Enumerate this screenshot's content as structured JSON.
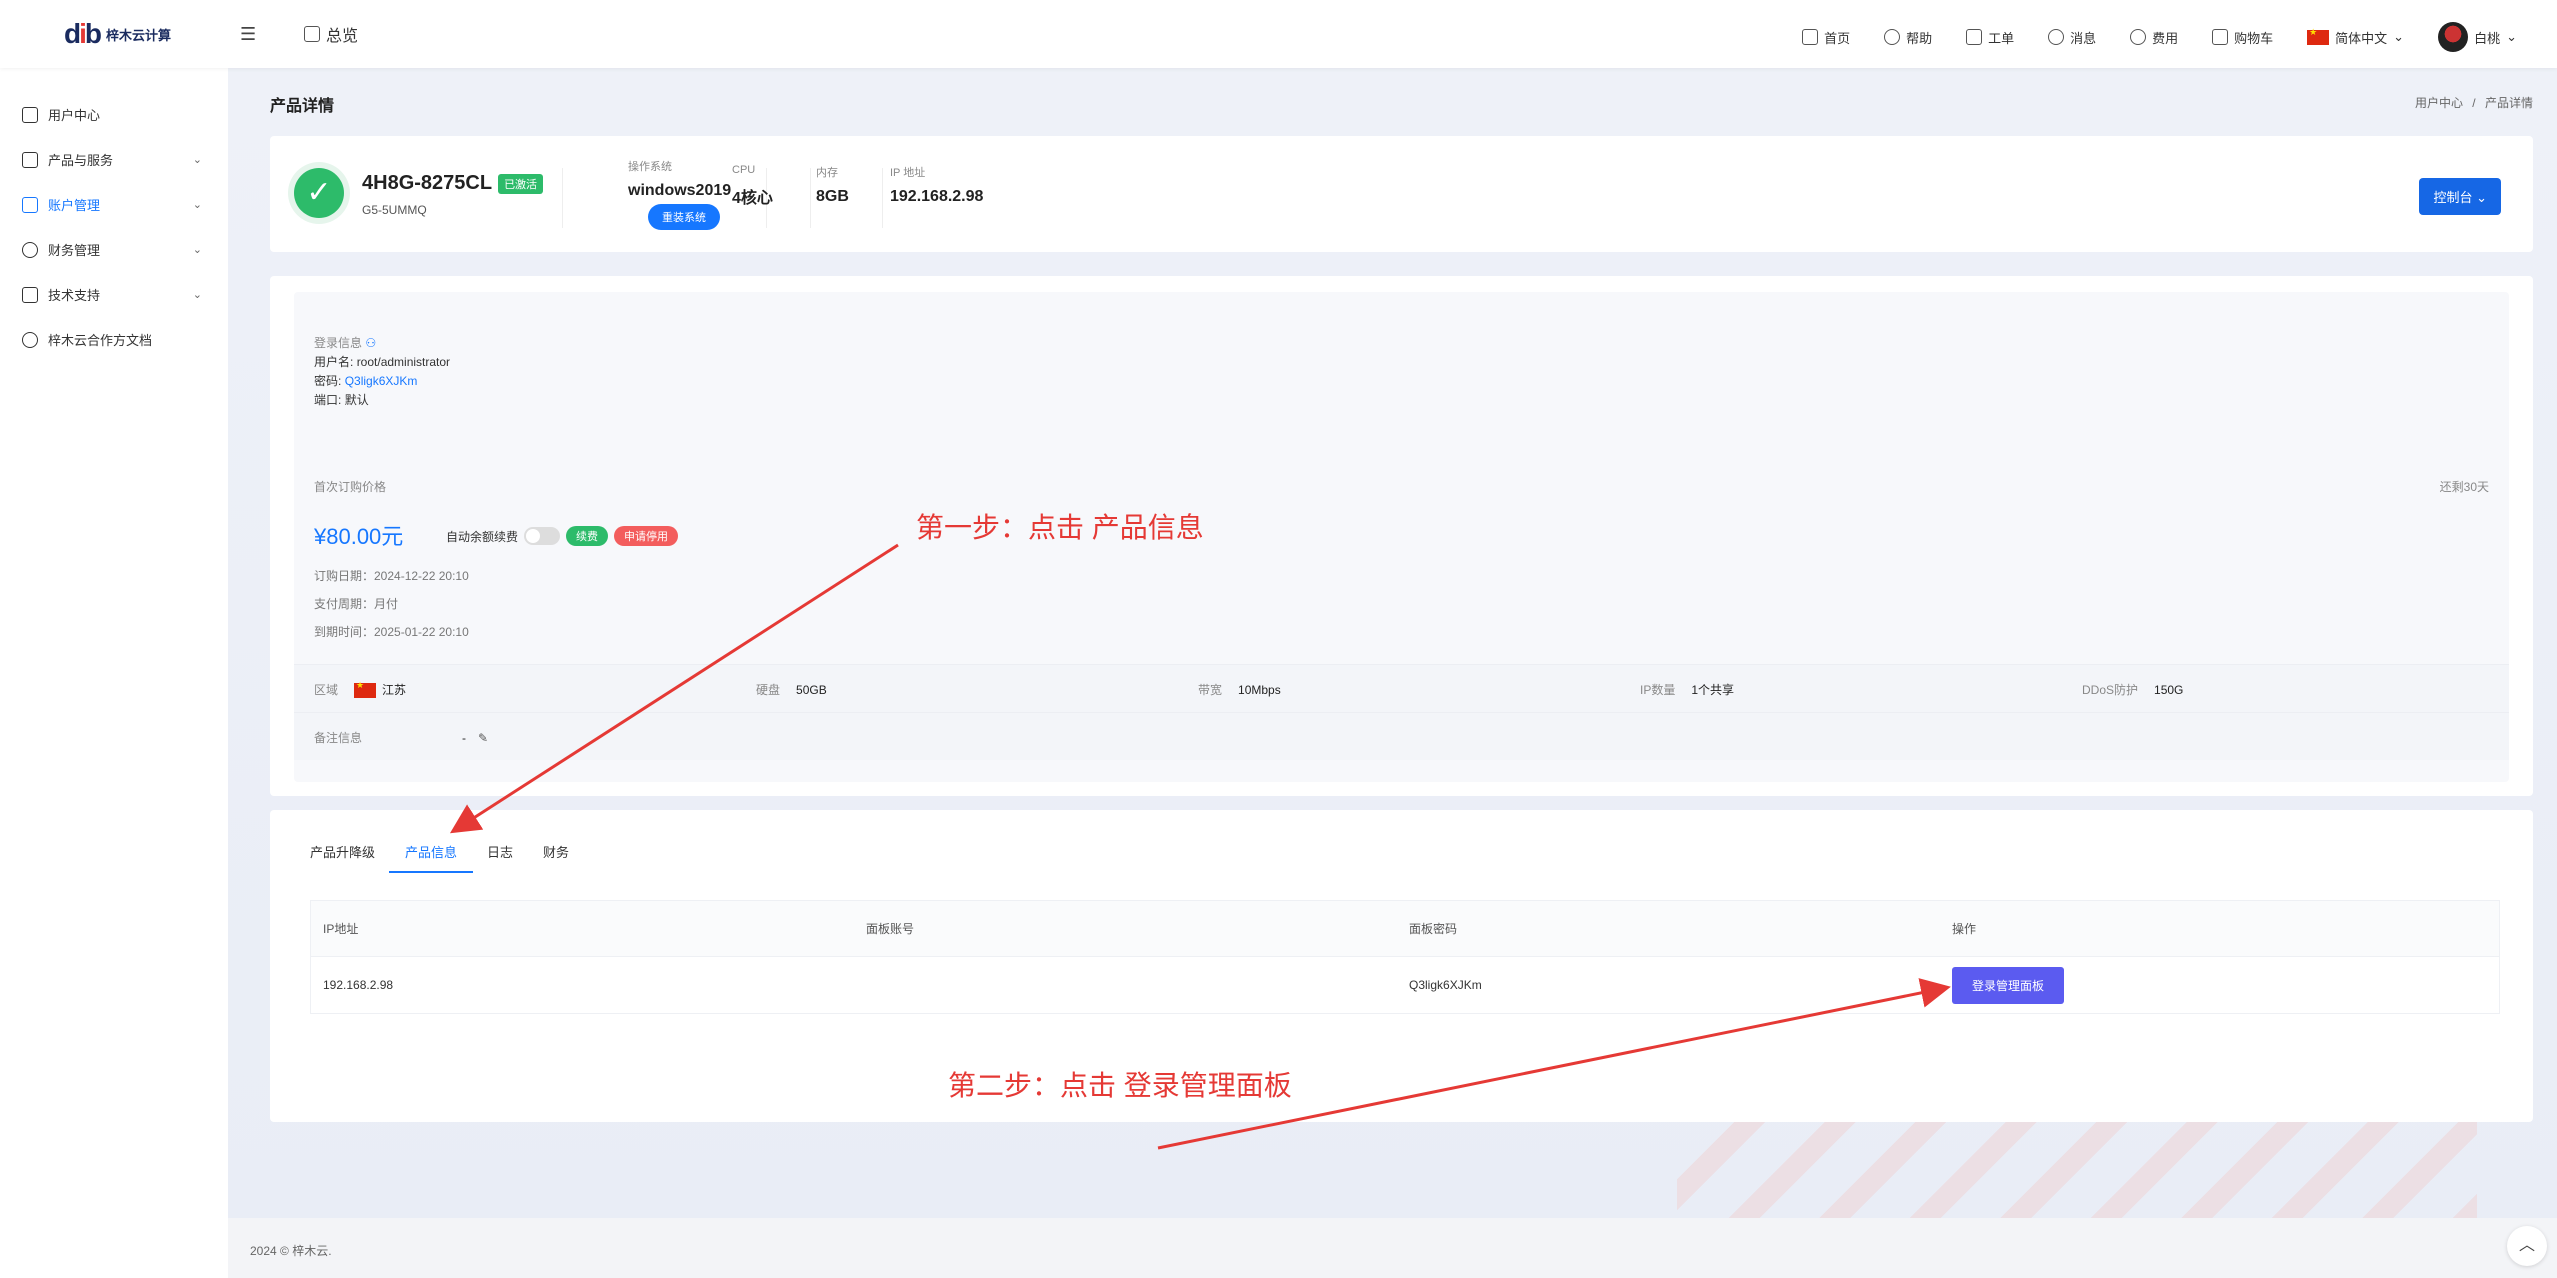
{
  "header": {
    "logo_text": "梓木云计算",
    "overview_label": "总览",
    "nav": [
      {
        "icon": "monitor-icon",
        "label": "首页"
      },
      {
        "icon": "help-icon",
        "label": "帮助"
      },
      {
        "icon": "ticket-icon",
        "label": "工单"
      },
      {
        "icon": "bell-icon",
        "label": "消息"
      },
      {
        "icon": "dollar-icon",
        "label": "费用"
      },
      {
        "icon": "cart-icon",
        "label": "购物车"
      }
    ],
    "language": "简体中文",
    "user_name": "白桃"
  },
  "sidebar": {
    "items": [
      {
        "icon": "home-icon",
        "label": "用户中心",
        "has_children": false,
        "active": false
      },
      {
        "icon": "grid-icon",
        "label": "产品与服务",
        "has_children": true,
        "active": false
      },
      {
        "icon": "user-icon",
        "label": "账户管理",
        "has_children": true,
        "active": true
      },
      {
        "icon": "dollar-icon",
        "label": "财务管理",
        "has_children": true,
        "active": false
      },
      {
        "icon": "support-icon",
        "label": "技术支持",
        "has_children": true,
        "active": false
      },
      {
        "icon": "share-icon",
        "label": "梓木云合作方文档",
        "has_children": false,
        "active": false
      }
    ]
  },
  "page": {
    "title": "产品详情",
    "breadcrumb": [
      "用户中心",
      "/",
      "产品详情"
    ]
  },
  "product": {
    "name": "4H8G-8275CL",
    "status_badge": "已激活",
    "code": "G5-5UMMQ",
    "os_label": "操作系统",
    "os_value": "windows2019",
    "reinstall_label": "重装系统",
    "cpu_label": "CPU",
    "cpu_value": "4核心",
    "memory_label": "内存",
    "memory_value": "8GB",
    "ip_label": "IP 地址",
    "ip_value": "192.168.2.98",
    "console_label": "控制台"
  },
  "details": {
    "login_title": "登录信息",
    "username_label": "用户名:",
    "username_value": "root/administrator",
    "password_label": "密码:",
    "password_value": "Q3ligk6XJKm",
    "port_label": "端口:",
    "port_value": "默认",
    "first_price_label": "首次订购价格",
    "price": "¥80.00元",
    "auto_renew_label": "自动余额续费",
    "renew_tag": "续费",
    "stop_tag": "申请停用",
    "remaining": "还剩30天",
    "order_date": "订购日期：2024-12-22 20:10",
    "billing_cycle": "支付周期：月付",
    "expire_date": "到期时间：2025-01-22 20:10",
    "region_label": "区域",
    "region_value": "江苏",
    "disk_label": "硬盘",
    "disk_value": "50GB",
    "bandwidth_label": "带宽",
    "bandwidth_value": "10Mbps",
    "ip_count_label": "IP数量",
    "ip_count_value": "1个共享",
    "ddos_label": "DDoS防护",
    "ddos_value": "150G",
    "remark_label": "备注信息",
    "remark_value": "-"
  },
  "tabs": [
    {
      "label": "产品升降级",
      "active": false
    },
    {
      "label": "产品信息",
      "active": true
    },
    {
      "label": "日志",
      "active": false
    },
    {
      "label": "财务",
      "active": false
    }
  ],
  "table": {
    "headers": [
      "IP地址",
      "面板账号",
      "面板密码",
      "操作"
    ],
    "rows": [
      {
        "ip": "192.168.2.98",
        "account": "",
        "password": "Q3ligk6XJKm",
        "action": "登录管理面板"
      }
    ]
  },
  "annotations": {
    "step1": "第一步：点击 产品信息",
    "step2": "第二步：点击 登录管理面板"
  },
  "footer": {
    "copyright": "2024 © 梓木云."
  },
  "colors": {
    "primary": "#1677ff",
    "success": "#2dbb6a",
    "danger": "#f35d5d",
    "annotation": "#e53935",
    "panel_button": "#5b5bf0"
  }
}
